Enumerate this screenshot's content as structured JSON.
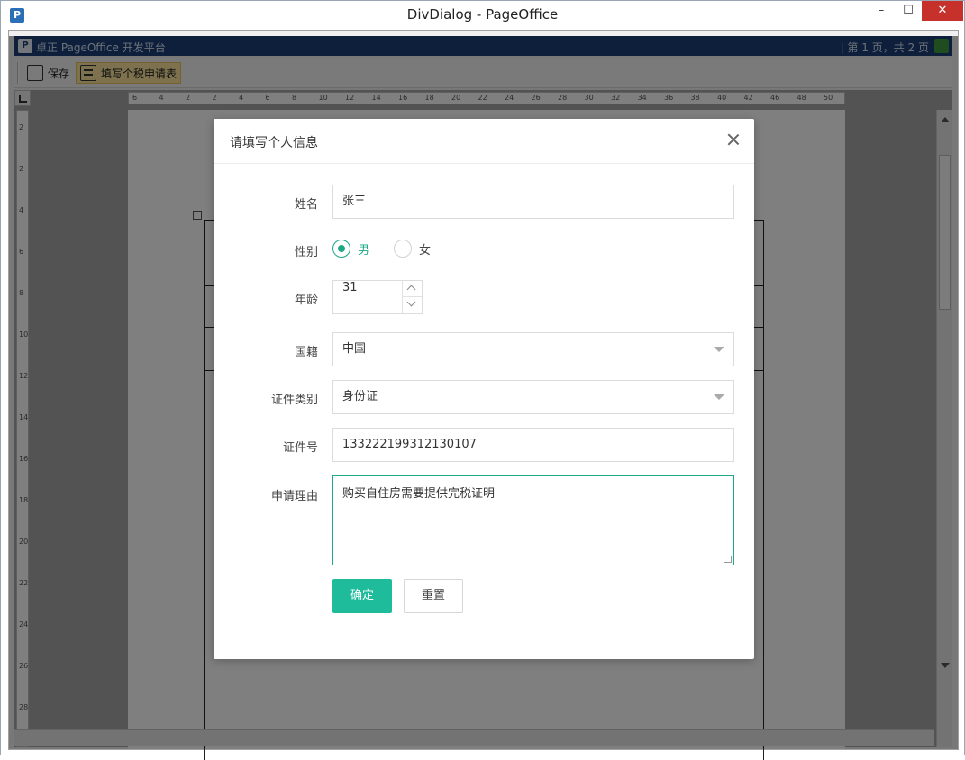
{
  "window": {
    "title": "DivDialog - PageOffice",
    "icon": "P",
    "min": "–",
    "max": "☐",
    "close": "✕"
  },
  "pageoffice": {
    "header_title": "卓正 PageOffice 开发平台",
    "page_info": "| 第 1 页，共 2 页",
    "toolbar": {
      "save_label": "保存",
      "apply_label": "填写个税申请表"
    }
  },
  "ruler": {
    "h_ticks": [
      "6",
      "4",
      "2",
      "2",
      "4",
      "6",
      "8",
      "10",
      "12",
      "14",
      "16",
      "18",
      "20",
      "22",
      "24",
      "26",
      "28",
      "30",
      "32",
      "34",
      "36",
      "38",
      "40",
      "42",
      "46",
      "48",
      "50"
    ],
    "v_ticks": [
      "2",
      "2",
      "4",
      "6",
      "8",
      "10",
      "12",
      "14",
      "16",
      "18",
      "20",
      "22",
      "24",
      "26",
      "28"
    ]
  },
  "dialog": {
    "title": "请填写个人信息",
    "fields": {
      "name": {
        "label": "姓名",
        "value": "张三"
      },
      "gender": {
        "label": "性别",
        "options": [
          "男",
          "女"
        ],
        "selected": "男"
      },
      "age": {
        "label": "年龄",
        "value": "31"
      },
      "nationality": {
        "label": "国籍",
        "value": "中国"
      },
      "id_type": {
        "label": "证件类别",
        "value": "身份证"
      },
      "id_number": {
        "label": "证件号",
        "value": "133222199312130107"
      },
      "reason": {
        "label": "申请理由",
        "value": "购买自住房需要提供完税证明"
      }
    },
    "buttons": {
      "confirm": "确定",
      "reset": "重置"
    }
  },
  "colors": {
    "accent": "#1ebc9b",
    "header": "#1c3f78",
    "close": "#c7312b"
  }
}
